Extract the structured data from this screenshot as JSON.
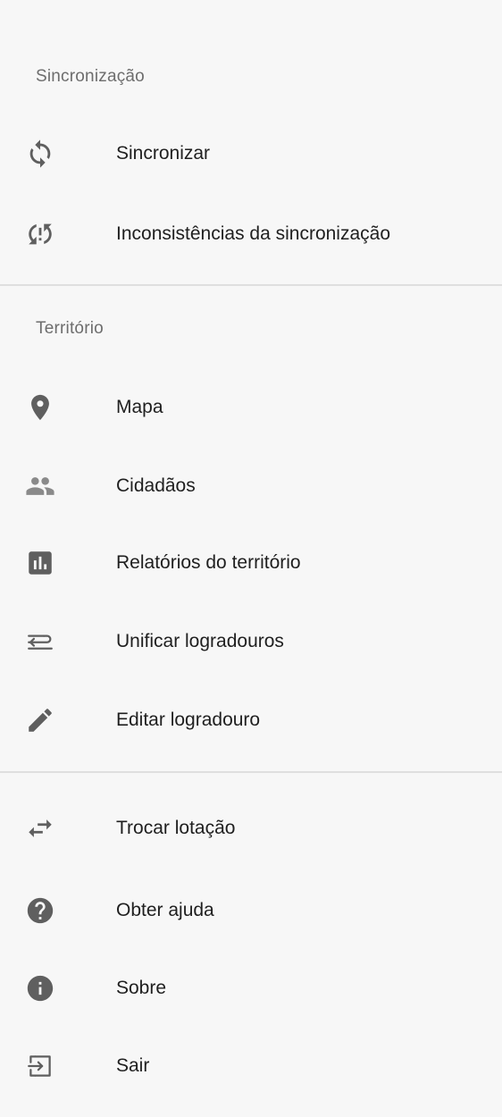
{
  "sections": {
    "sync": {
      "header": "Sincronização",
      "items": [
        {
          "label": "Sincronizar",
          "icon": "sync-icon"
        },
        {
          "label": "Inconsistências da sincronização",
          "icon": "sync-problem-icon"
        }
      ]
    },
    "territory": {
      "header": "Território",
      "items": [
        {
          "label": "Mapa",
          "icon": "map-pin-icon"
        },
        {
          "label": "Cidadãos",
          "icon": "people-icon"
        },
        {
          "label": "Relatórios do território",
          "icon": "bar-chart-icon"
        },
        {
          "label": "Unificar logradouros",
          "icon": "merge-lines-icon"
        },
        {
          "label": "Editar logradouro",
          "icon": "pencil-icon"
        }
      ]
    },
    "other": {
      "items": [
        {
          "label": "Trocar lotação",
          "icon": "swap-arrows-icon"
        },
        {
          "label": "Obter ajuda",
          "icon": "help-icon"
        },
        {
          "label": "Sobre",
          "icon": "info-icon"
        },
        {
          "label": "Sair",
          "icon": "exit-icon"
        }
      ]
    }
  },
  "colors": {
    "background": "#f7f7f7",
    "icon": "#5f5f5f",
    "text": "#1f1f1f",
    "header_text": "#6d6d6d",
    "divider": "#dfdfdf"
  }
}
